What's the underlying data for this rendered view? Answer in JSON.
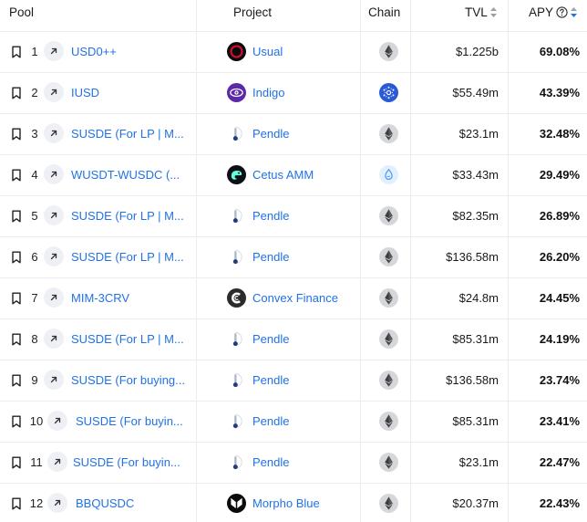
{
  "header": {
    "pool": "Pool",
    "project": "Project",
    "chain": "Chain",
    "tvl": "TVL",
    "apy": "APY"
  },
  "colors": {
    "link": "#2172e5",
    "sort_active": "#2172e5",
    "sort_inactive": "#9aa0aa",
    "divider": "#e9ecf1"
  },
  "rows": [
    {
      "rank": "1",
      "pool": "USD0++",
      "project": "Usual",
      "project_icon": "usual-icon",
      "chain_icon": "ethereum-icon",
      "tvl": "$1.225b",
      "apy": "69.08%"
    },
    {
      "rank": "2",
      "pool": "IUSD",
      "project": "Indigo",
      "project_icon": "indigo-icon",
      "chain_icon": "cardano-icon",
      "tvl": "$55.49m",
      "apy": "43.39%"
    },
    {
      "rank": "3",
      "pool": "SUSDE (For LP | M...",
      "project": "Pendle",
      "project_icon": "pendle-icon",
      "chain_icon": "ethereum-icon",
      "tvl": "$23.1m",
      "apy": "32.48%"
    },
    {
      "rank": "4",
      "pool": "WUSDT-WUSDC (...",
      "project": "Cetus AMM",
      "project_icon": "cetus-icon",
      "chain_icon": "sui-icon",
      "tvl": "$33.43m",
      "apy": "29.49%"
    },
    {
      "rank": "5",
      "pool": "SUSDE (For LP | M...",
      "project": "Pendle",
      "project_icon": "pendle-icon",
      "chain_icon": "ethereum-icon",
      "tvl": "$82.35m",
      "apy": "26.89%"
    },
    {
      "rank": "6",
      "pool": "SUSDE (For LP | M...",
      "project": "Pendle",
      "project_icon": "pendle-icon",
      "chain_icon": "ethereum-icon",
      "tvl": "$136.58m",
      "apy": "26.20%"
    },
    {
      "rank": "7",
      "pool": "MIM-3CRV",
      "project": "Convex Finance",
      "project_icon": "convex-icon",
      "chain_icon": "ethereum-icon",
      "tvl": "$24.8m",
      "apy": "24.45%"
    },
    {
      "rank": "8",
      "pool": "SUSDE (For LP | M...",
      "project": "Pendle",
      "project_icon": "pendle-icon",
      "chain_icon": "ethereum-icon",
      "tvl": "$85.31m",
      "apy": "24.19%"
    },
    {
      "rank": "9",
      "pool": "SUSDE (For buying...",
      "project": "Pendle",
      "project_icon": "pendle-icon",
      "chain_icon": "ethereum-icon",
      "tvl": "$136.58m",
      "apy": "23.74%"
    },
    {
      "rank": "10",
      "pool": "SUSDE (For buyin...",
      "project": "Pendle",
      "project_icon": "pendle-icon",
      "chain_icon": "ethereum-icon",
      "tvl": "$85.31m",
      "apy": "23.41%"
    },
    {
      "rank": "11",
      "pool": "SUSDE (For buyin...",
      "project": "Pendle",
      "project_icon": "pendle-icon",
      "chain_icon": "ethereum-icon",
      "tvl": "$23.1m",
      "apy": "22.47%"
    },
    {
      "rank": "12",
      "pool": "BBQUSDC",
      "project": "Morpho Blue",
      "project_icon": "morpho-icon",
      "chain_icon": "ethereum-icon",
      "tvl": "$20.37m",
      "apy": "22.43%"
    }
  ]
}
